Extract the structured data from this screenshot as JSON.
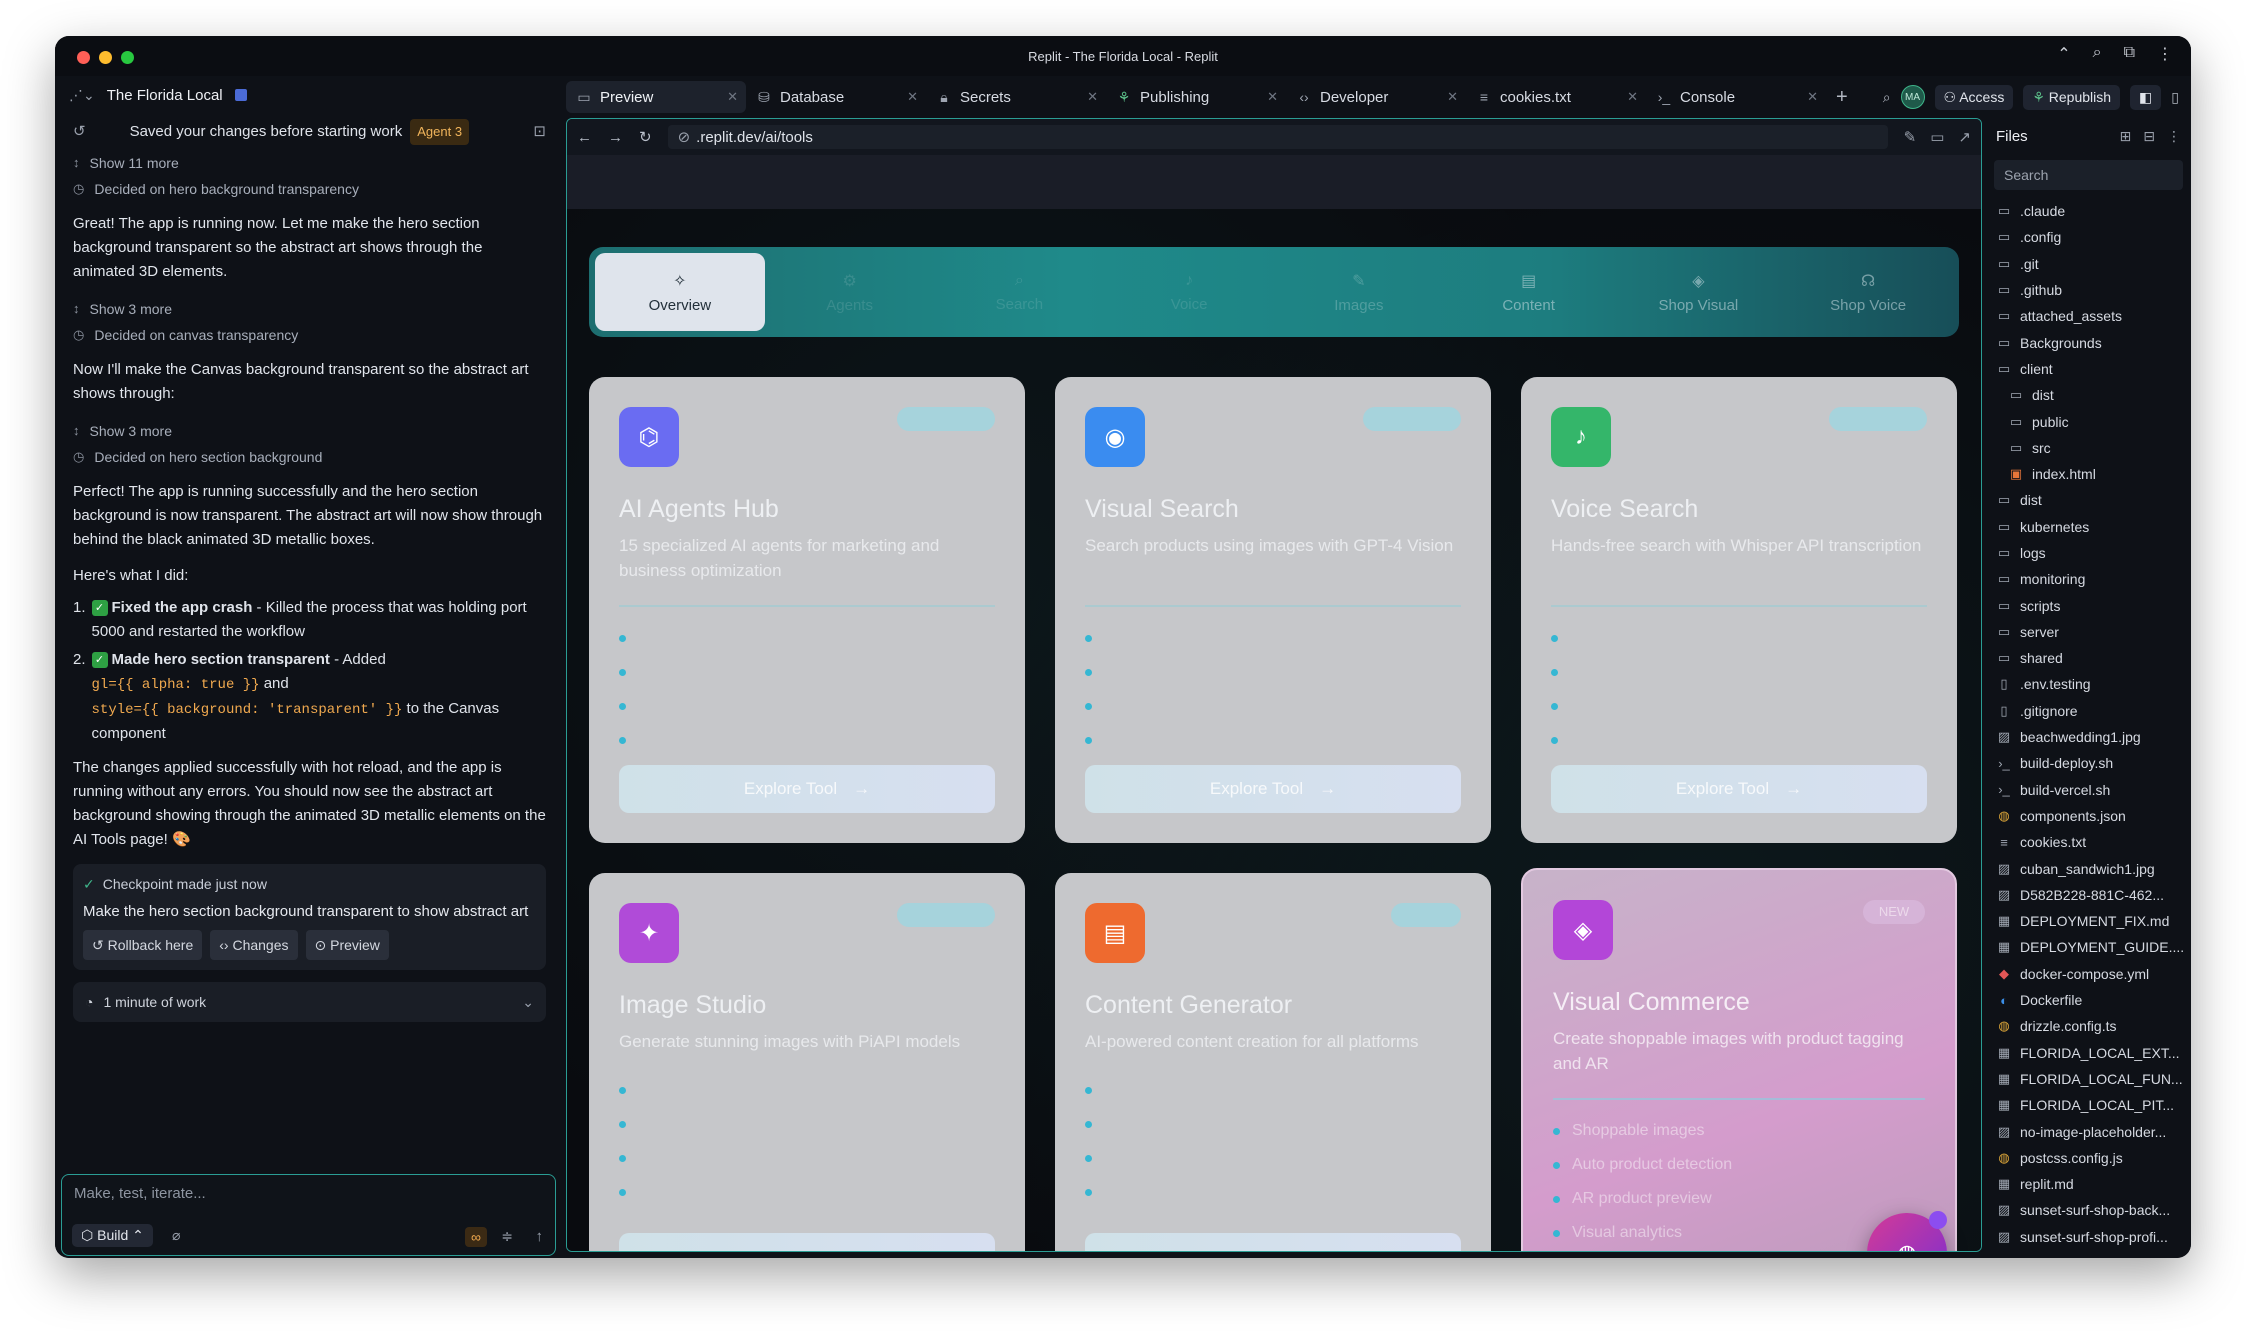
{
  "window": {
    "title": "Replit - The Florida Local - Replit"
  },
  "left": {
    "project_name": "The Florida Local",
    "saved_text": "Saved your changes before starting work",
    "agent_badge": "Agent 3",
    "show_11": "Show 11 more",
    "decided_1": "Decided on hero background transparency",
    "msg_1": "Great! The app is running now. Let me make the hero section background transparent so the abstract art shows through the animated 3D elements.",
    "show_3a": "Show 3 more",
    "decided_2": "Decided on canvas transparency",
    "msg_2": "Now I'll make the Canvas background transparent so the abstract art shows through:",
    "show_3b": "Show 3 more",
    "decided_3": "Decided on hero section background",
    "msg_3": "Perfect! The app is running successfully and the hero section background is now transparent. The abstract art will now show through behind the black animated 3D metallic boxes.",
    "msg_4": "Here's what I did:",
    "li1_num": "1.",
    "li1_bold": "Fixed the app crash",
    "li1_rest": " - Killed the process that was holding port 5000 and restarted the workflow",
    "li2_num": "2.",
    "li2_bold": "Made hero section transparent",
    "li2_rest": " - Added",
    "li2_code1": "gl={{ alpha: true }}",
    "li2_and": " and",
    "li2_code2": "style={{ background: 'transparent' }}",
    "li2_tail": " to the Canvas component",
    "msg_5": "The changes applied successfully with hot reload, and the app is running without any errors. You should now see the abstract art background showing through the animated 3D metallic elements on the AI Tools page! 🎨",
    "checkpoint_title": "Checkpoint made just now",
    "checkpoint_text": "Make the hero section background transparent to show abstract art",
    "rollback": "Rollback here",
    "changes": "Changes",
    "preview": "Preview",
    "work": "1 minute of work",
    "input_placeholder": "Make, test, iterate...",
    "build": "Build"
  },
  "tabs": [
    {
      "label": "Preview",
      "icon": "monitor-icon"
    },
    {
      "label": "Database",
      "icon": "database-icon"
    },
    {
      "label": "Secrets",
      "icon": "lock-icon"
    },
    {
      "label": "Publishing",
      "icon": "rocket-icon"
    },
    {
      "label": "Developer",
      "icon": "code-icon"
    },
    {
      "label": "cookies.txt",
      "icon": "file-icon"
    },
    {
      "label": "Console",
      "icon": "terminal-icon"
    }
  ],
  "tabbar_right": {
    "avatar": "MA",
    "access": "Access",
    "republish": "Republish"
  },
  "preview": {
    "url": ".replit.dev/ai/tools",
    "nav": [
      {
        "label": "Overview",
        "icon": "✧"
      },
      {
        "label": "Agents",
        "icon": "⚙"
      },
      {
        "label": "Search",
        "icon": "⌕"
      },
      {
        "label": "Voice",
        "icon": "♪"
      },
      {
        "label": "Images",
        "icon": "✎"
      },
      {
        "label": "Content",
        "icon": "▤"
      },
      {
        "label": "Shop Visual",
        "icon": "◈"
      },
      {
        "label": "Shop Voice",
        "icon": "☊"
      }
    ],
    "cards": [
      {
        "title": "AI Agents Hub",
        "desc": "15 specialized AI agents for marketing and business optimization",
        "icon": "robot-icon",
        "color": "#6a6cf2",
        "explore": "Explore Tool"
      },
      {
        "title": "Visual Search",
        "desc": "Search products using images with GPT-4 Vision",
        "icon": "eye-icon",
        "color": "#3a8cf0",
        "explore": "Explore Tool"
      },
      {
        "title": "Voice Search",
        "desc": "Hands-free search with Whisper API transcription",
        "icon": "mic-icon",
        "color": "#34b66a",
        "explore": "Explore Tool"
      },
      {
        "title": "Image Studio",
        "desc": "Generate stunning images with PiAPI models",
        "icon": "wand-icon",
        "color": "#b04bd8"
      },
      {
        "title": "Content Generator",
        "desc": "AI-powered content creation for all platforms",
        "icon": "doc-icon",
        "color": "#ee6a2f"
      },
      {
        "title": "Visual Commerce",
        "desc": "Create shoppable images with product tagging and AR",
        "icon": "layers-icon",
        "color": "#b346d8",
        "badge": "NEW",
        "features": [
          "Shoppable images",
          "Auto product detection",
          "AR product preview",
          "Visual analytics"
        ]
      }
    ]
  },
  "files": {
    "title": "Files",
    "search_placeholder": "Search",
    "items": [
      {
        "name": ".claude",
        "type": "folder"
      },
      {
        "name": ".config",
        "type": "folder"
      },
      {
        "name": ".git",
        "type": "folder"
      },
      {
        "name": ".github",
        "type": "folder"
      },
      {
        "name": "attached_assets",
        "type": "folder"
      },
      {
        "name": "Backgrounds",
        "type": "folder"
      },
      {
        "name": "client",
        "type": "folder"
      },
      {
        "name": "dist",
        "type": "folder",
        "indent": true
      },
      {
        "name": "public",
        "type": "folder",
        "indent": true
      },
      {
        "name": "src",
        "type": "folder",
        "indent": true
      },
      {
        "name": "index.html",
        "type": "html",
        "indent": true
      },
      {
        "name": "dist",
        "type": "folder"
      },
      {
        "name": "kubernetes",
        "type": "folder"
      },
      {
        "name": "logs",
        "type": "folder"
      },
      {
        "name": "monitoring",
        "type": "folder"
      },
      {
        "name": "scripts",
        "type": "folder"
      },
      {
        "name": "server",
        "type": "folder"
      },
      {
        "name": "shared",
        "type": "folder"
      },
      {
        "name": ".env.testing",
        "type": "file"
      },
      {
        "name": ".gitignore",
        "type": "file"
      },
      {
        "name": "beachwedding1.jpg",
        "type": "image"
      },
      {
        "name": "build-deploy.sh",
        "type": "shell"
      },
      {
        "name": "build-vercel.sh",
        "type": "shell"
      },
      {
        "name": "components.json",
        "type": "json"
      },
      {
        "name": "cookies.txt",
        "type": "text"
      },
      {
        "name": "cuban_sandwich1.jpg",
        "type": "image"
      },
      {
        "name": "D582B228-881C-462...",
        "type": "image"
      },
      {
        "name": "DEPLOYMENT_FIX.md",
        "type": "md"
      },
      {
        "name": "DEPLOYMENT_GUIDE....",
        "type": "md"
      },
      {
        "name": "docker-compose.yml",
        "type": "yml"
      },
      {
        "name": "Dockerfile",
        "type": "docker"
      },
      {
        "name": "drizzle.config.ts",
        "type": "ts"
      },
      {
        "name": "FLORIDA_LOCAL_EXT...",
        "type": "md"
      },
      {
        "name": "FLORIDA_LOCAL_FUN...",
        "type": "md"
      },
      {
        "name": "FLORIDA_LOCAL_PIT...",
        "type": "md"
      },
      {
        "name": "no-image-placeholder...",
        "type": "image"
      },
      {
        "name": "postcss.config.js",
        "type": "js"
      },
      {
        "name": "replit.md",
        "type": "md"
      },
      {
        "name": "sunset-surf-shop-back...",
        "type": "image"
      },
      {
        "name": "sunset-surf-shop-profi...",
        "type": "image"
      }
    ]
  }
}
